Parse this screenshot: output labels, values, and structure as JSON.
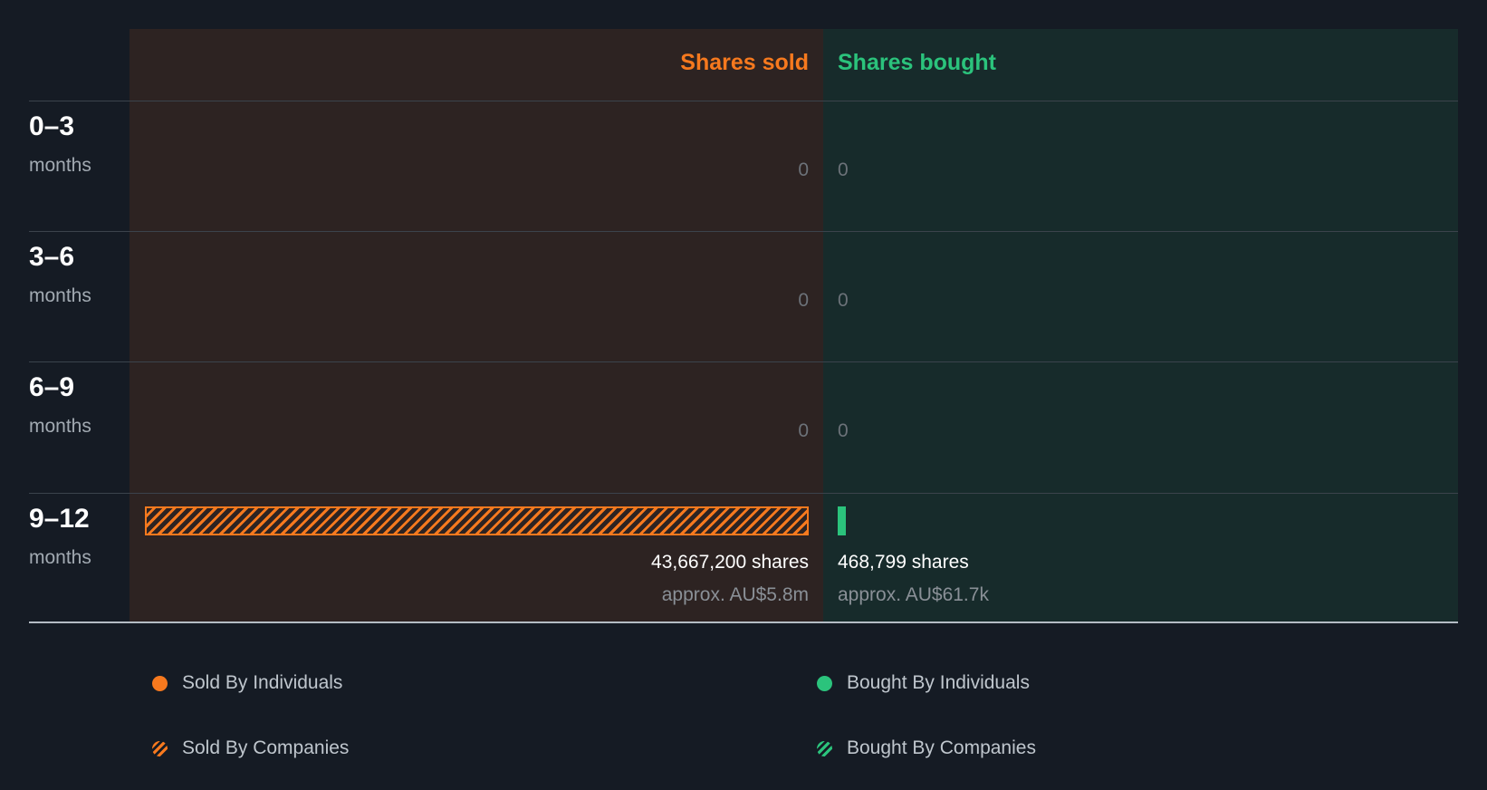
{
  "colors": {
    "sold": "#f6791e",
    "bought": "#2bc37c",
    "sold_bg": "#2d2322",
    "bought_bg": "#172b2b",
    "page_bg": "#151b24"
  },
  "header": {
    "sold": "Shares sold",
    "bought": "Shares bought"
  },
  "rows": [
    {
      "period": "0–3",
      "unit": "months",
      "sold": "0",
      "bought": "0"
    },
    {
      "period": "3–6",
      "unit": "months",
      "sold": "0",
      "bought": "0"
    },
    {
      "period": "6–9",
      "unit": "months",
      "sold": "0",
      "bought": "0"
    },
    {
      "period": "9–12",
      "unit": "months",
      "sold_shares": "43,667,200 shares",
      "sold_approx": "approx. AU$5.8m",
      "bought_shares": "468,799 shares",
      "bought_approx": "approx. AU$61.7k"
    }
  ],
  "legend": {
    "sold_individuals": "Sold By Individuals",
    "sold_companies": "Sold By Companies",
    "bought_individuals": "Bought By Individuals",
    "bought_companies": "Bought By Companies"
  },
  "chart_data": {
    "type": "bar",
    "categories": [
      "0–3",
      "3–6",
      "6–9",
      "9–12"
    ],
    "series": [
      {
        "name": "Sold By Individuals",
        "values": [
          0,
          0,
          0,
          0
        ]
      },
      {
        "name": "Sold By Companies",
        "values": [
          0,
          0,
          0,
          43667200
        ]
      },
      {
        "name": "Bought By Individuals",
        "values": [
          0,
          0,
          0,
          468799
        ]
      },
      {
        "name": "Bought By Companies",
        "values": [
          0,
          0,
          0,
          0
        ]
      }
    ],
    "value_labels": {
      "sold": [
        "0",
        "0",
        "0",
        "43,667,200 shares"
      ],
      "bought": [
        "0",
        "0",
        "0",
        "468,799 shares"
      ]
    },
    "approx_values": {
      "sold": [
        null,
        null,
        null,
        "approx. AU$5.8m"
      ],
      "bought": [
        null,
        null,
        null,
        "approx. AU$61.7k"
      ]
    },
    "xlabel": "",
    "ylabel": "",
    "legend_position": "bottom"
  }
}
